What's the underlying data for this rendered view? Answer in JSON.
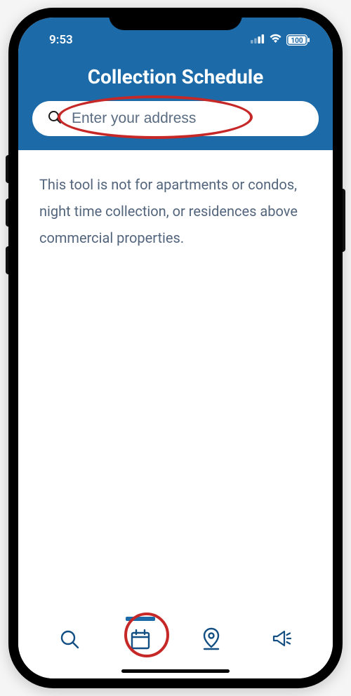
{
  "status": {
    "time": "9:53",
    "battery": "100"
  },
  "header": {
    "title": "Collection Schedule"
  },
  "search": {
    "placeholder": "Enter your address"
  },
  "content": {
    "disclaimer": "This tool is not for apartments or condos, night time collection, or residences above commercial properties."
  }
}
